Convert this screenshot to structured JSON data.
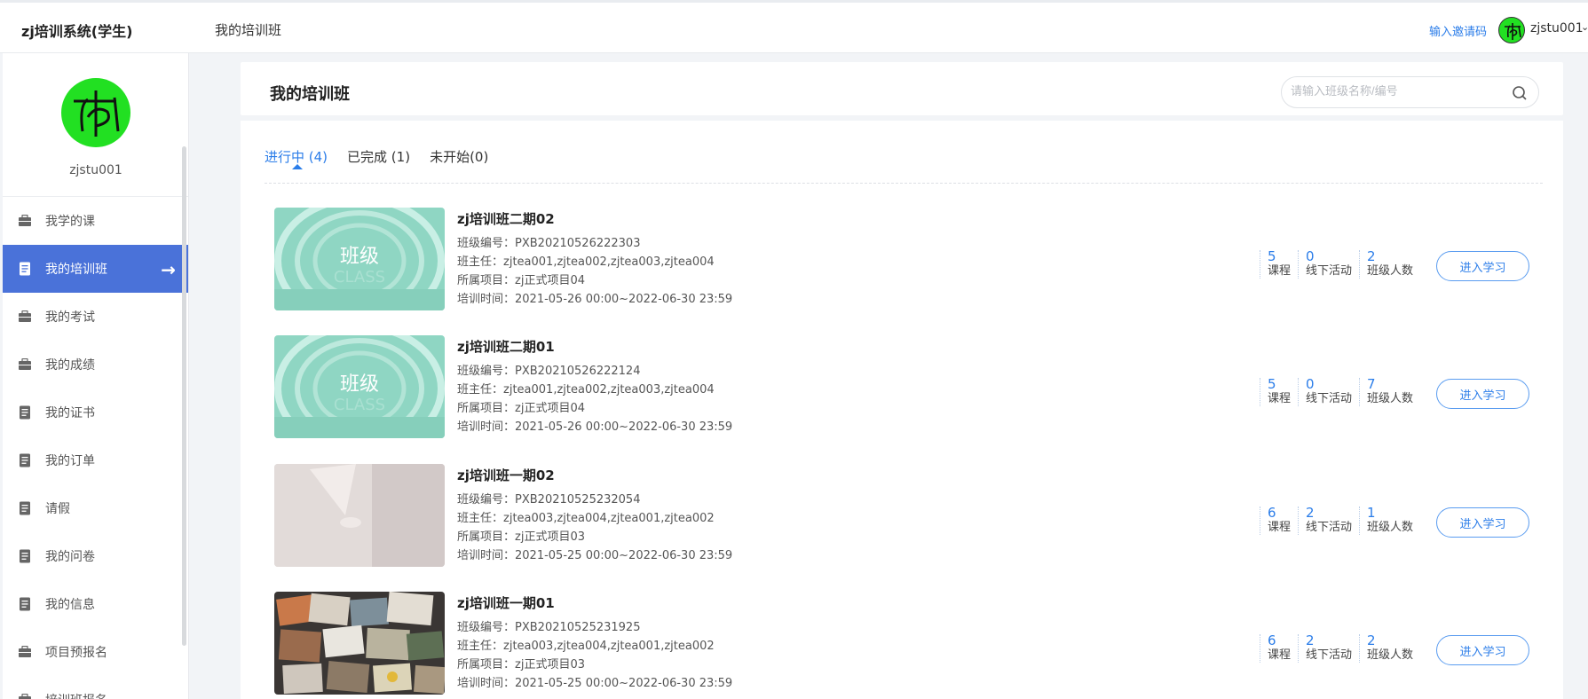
{
  "topbar": {
    "brand": "zj培训系统(学生)",
    "nav": "我的培训班",
    "invite": "输入邀请码",
    "username": "zjstu001"
  },
  "sidebar": {
    "username": "zjstu001",
    "items": [
      {
        "label": "我学的课",
        "icon": "briefcase-icon"
      },
      {
        "label": "我的培训班",
        "icon": "document-icon",
        "active": true
      },
      {
        "label": "我的考试",
        "icon": "briefcase-icon"
      },
      {
        "label": "我的成绩",
        "icon": "briefcase-icon"
      },
      {
        "label": "我的证书",
        "icon": "document-icon"
      },
      {
        "label": "我的订单",
        "icon": "document-icon"
      },
      {
        "label": "请假",
        "icon": "document-icon"
      },
      {
        "label": "我的问卷",
        "icon": "document-icon"
      },
      {
        "label": "我的信息",
        "icon": "document-icon"
      },
      {
        "label": "项目预报名",
        "icon": "briefcase-icon"
      },
      {
        "label": "培训班报名",
        "icon": "briefcase-icon"
      }
    ]
  },
  "main": {
    "title": "我的培训班",
    "search_placeholder": "请输入班级名称/编号",
    "tabs": [
      {
        "label": "进行中 (4)",
        "active": true
      },
      {
        "label": "已完成 (1)"
      },
      {
        "label": "未开始(0)"
      }
    ],
    "labels": {
      "code": "班级编号：",
      "teachers": "班主任：",
      "project": "所属项目：",
      "time": "培训时间：",
      "courses": "课程",
      "offline": "线下活动",
      "members": "班级人数",
      "enter": "进入学习"
    },
    "classes": [
      {
        "name": "zj培训班二期02",
        "code": "PXB20210526222303",
        "teachers": "zjtea001,zjtea002,zjtea003,zjtea004",
        "project": "zj正式项目04",
        "time": "2021-05-26 00:00~2022-06-30 23:59",
        "courses": "5",
        "offline": "0",
        "members": "2",
        "thumb": "class-cover",
        "thumb_text": "班级",
        "thumb_sub": "CLASS"
      },
      {
        "name": "zj培训班二期01",
        "code": "PXB20210526222124",
        "teachers": "zjtea001,zjtea002,zjtea003,zjtea004",
        "project": "zj正式项目04",
        "time": "2021-05-26 00:00~2022-06-30 23:59",
        "courses": "5",
        "offline": "0",
        "members": "7",
        "thumb": "class-cover",
        "thumb_text": "班级",
        "thumb_sub": "CLASS"
      },
      {
        "name": "zj培训班一期02",
        "code": "PXB20210525232054",
        "teachers": "zjtea003,zjtea004,zjtea001,zjtea002",
        "project": "zj正式项目03",
        "time": "2021-05-25 00:00~2022-06-30 23:59",
        "courses": "6",
        "offline": "2",
        "members": "1",
        "thumb": "wall-photo"
      },
      {
        "name": "zj培训班一期01",
        "code": "PXB20210525231925",
        "teachers": "zjtea003,zjtea004,zjtea001,zjtea002",
        "project": "zj正式项目03",
        "time": "2021-05-25 00:00~2022-06-30 23:59",
        "courses": "6",
        "offline": "2",
        "members": "2",
        "thumb": "photos-collage"
      }
    ]
  }
}
